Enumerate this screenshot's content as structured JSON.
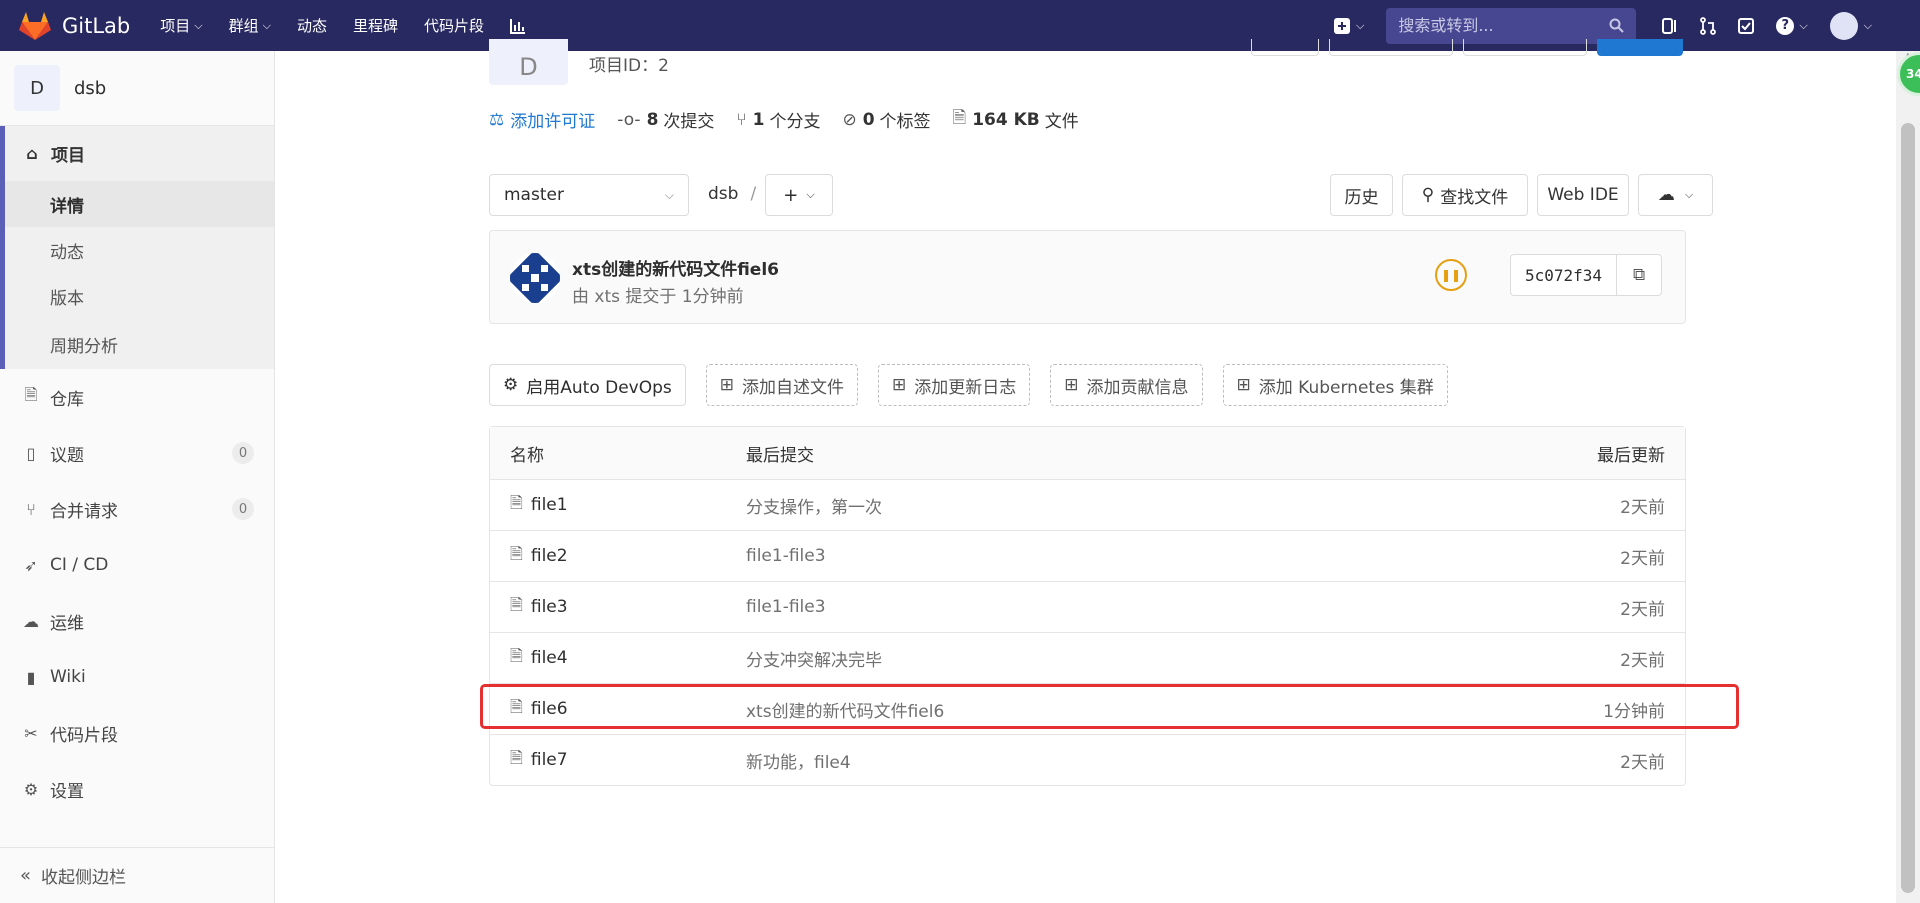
{
  "navbar": {
    "brand": "GitLab",
    "items": [
      {
        "label": "项目",
        "dropdown": true
      },
      {
        "label": "群组",
        "dropdown": true
      },
      {
        "label": "动态",
        "dropdown": false
      },
      {
        "label": "里程碑",
        "dropdown": false
      },
      {
        "label": "代码片段",
        "dropdown": false
      }
    ],
    "search_placeholder": "搜索或转到..."
  },
  "sidebar": {
    "project_initial": "D",
    "project_name": "dsb",
    "section_label": "项目",
    "sub_items": [
      "详情",
      "动态",
      "版本",
      "周期分析"
    ],
    "items": [
      {
        "label": "仓库",
        "icon": "repository-icon"
      },
      {
        "label": "议题",
        "icon": "issues-icon",
        "badge": "0"
      },
      {
        "label": "合并请求",
        "icon": "merge-request-icon",
        "badge": "0"
      },
      {
        "label": "CI / CD",
        "icon": "rocket-icon"
      },
      {
        "label": "运维",
        "icon": "operations-icon"
      },
      {
        "label": "Wiki",
        "icon": "book-icon"
      },
      {
        "label": "代码片段",
        "icon": "snippet-icon"
      },
      {
        "label": "设置",
        "icon": "gear-icon"
      }
    ],
    "collapse_label": "收起侧边栏"
  },
  "project": {
    "avatar_letter": "D",
    "id_label": "项目ID：2",
    "license": "添加许可证",
    "commits_count": "8",
    "commits_label": "次提交",
    "branches_count": "1",
    "branches_label": "个分支",
    "tags_count": "0",
    "tags_label": "个标签",
    "size_value": "164 KB",
    "size_label": "文件"
  },
  "toolbar": {
    "branch": "master",
    "path": "dsb",
    "separator": "/",
    "history": "历史",
    "find_file": "查找文件",
    "web_ide": "Web IDE"
  },
  "last_commit": {
    "title": "xts创建的新代码文件fiel6",
    "meta": "由 xts 提交于 1分钟前",
    "sha": "5c072f34"
  },
  "actions": [
    "启用Auto DevOps",
    "添加自述文件",
    "添加更新日志",
    "添加贡献信息",
    "添加 Kubernetes 集群"
  ],
  "files": {
    "headers": {
      "name": "名称",
      "commit": "最后提交",
      "updated": "最后更新"
    },
    "rows": [
      {
        "name": "file1",
        "commit": "分支操作，第一次",
        "updated": "2天前"
      },
      {
        "name": "file2",
        "commit": "file1-file3",
        "updated": "2天前"
      },
      {
        "name": "file3",
        "commit": "file1-file3",
        "updated": "2天前"
      },
      {
        "name": "file4",
        "commit": "分支冲突解决完毕",
        "updated": "2天前"
      },
      {
        "name": "file6",
        "commit": "xts创建的新代码文件fiel6",
        "updated": "1分钟前"
      },
      {
        "name": "file7",
        "commit": "新功能，file4",
        "updated": "2天前"
      }
    ]
  },
  "float_badge": "34"
}
